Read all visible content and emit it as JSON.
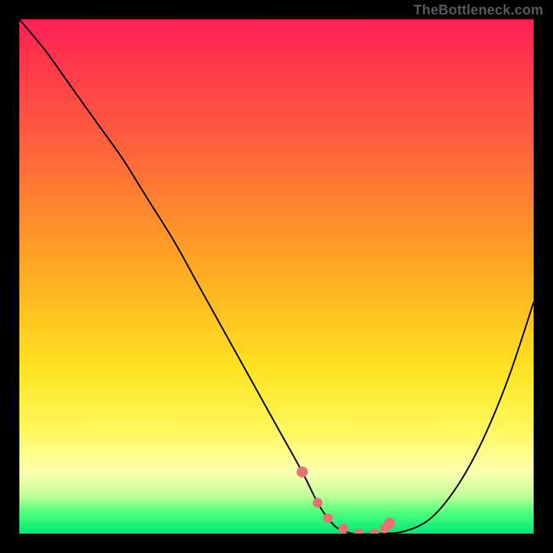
{
  "attribution": "TheBottleneck.com",
  "colors": {
    "background": "#000000",
    "gradient_top": "#ff1f54",
    "gradient_mid": "#ffe321",
    "gradient_bottom": "#00e676",
    "curve": "#000000",
    "marker": "#e57373"
  },
  "chart_data": {
    "type": "line",
    "title": "",
    "xlabel": "",
    "ylabel": "",
    "xlim": [
      0,
      100
    ],
    "ylim": [
      0,
      100
    ],
    "series": [
      {
        "name": "bottleneck-curve",
        "x": [
          0,
          5,
          10,
          15,
          20,
          25,
          30,
          35,
          40,
          45,
          50,
          55,
          58,
          60,
          62,
          65,
          70,
          75,
          80,
          85,
          90,
          95,
          100
        ],
        "values": [
          100,
          94,
          87,
          80,
          73,
          65,
          57,
          48,
          39,
          30,
          21,
          12,
          6,
          3,
          1,
          0,
          0,
          0.5,
          3,
          9,
          18,
          30,
          45
        ]
      }
    ],
    "markers": {
      "name": "highlight-dots",
      "x": [
        55,
        58,
        60,
        63,
        66,
        69,
        71,
        72
      ],
      "values": [
        12,
        6,
        3,
        1,
        0,
        0,
        1,
        2
      ]
    }
  }
}
